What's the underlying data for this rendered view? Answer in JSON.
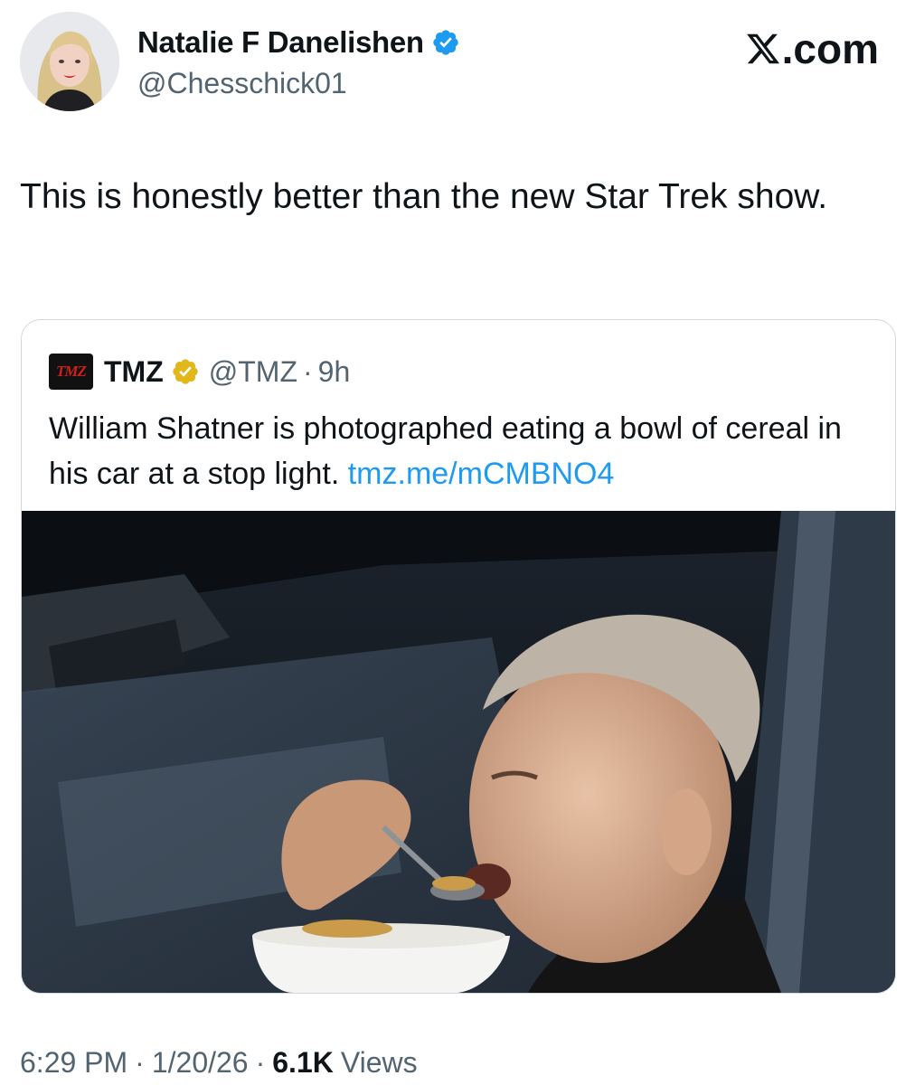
{
  "author": {
    "display_name": "Natalie F Danelishen",
    "handle": "@Chesschick01",
    "verified_color": "#1d9bf0"
  },
  "brand": {
    "label": ".com",
    "icon": "x-logo-icon"
  },
  "tweet": {
    "text": "This is honestly better than the new Star Trek show."
  },
  "quoted": {
    "logo_text": "TMZ",
    "display_name": "TMZ",
    "verified_color": "#e2b719",
    "handle": "@TMZ",
    "separator": "·",
    "time": "9h",
    "text": "William Shatner is photographed eating a bowl of cereal in his car at a stop light.",
    "link": "tmz.me/mCMBNO4",
    "image": "photo-man-eating-cereal-in-car"
  },
  "meta": {
    "time": "6:29 PM",
    "date": "1/20/26",
    "views_count": "6.1K",
    "views_label": "Views",
    "separator": "·"
  },
  "colors": {
    "link": "#1d9bf0",
    "secondary_text": "#536471",
    "border": "#cfd9de"
  }
}
